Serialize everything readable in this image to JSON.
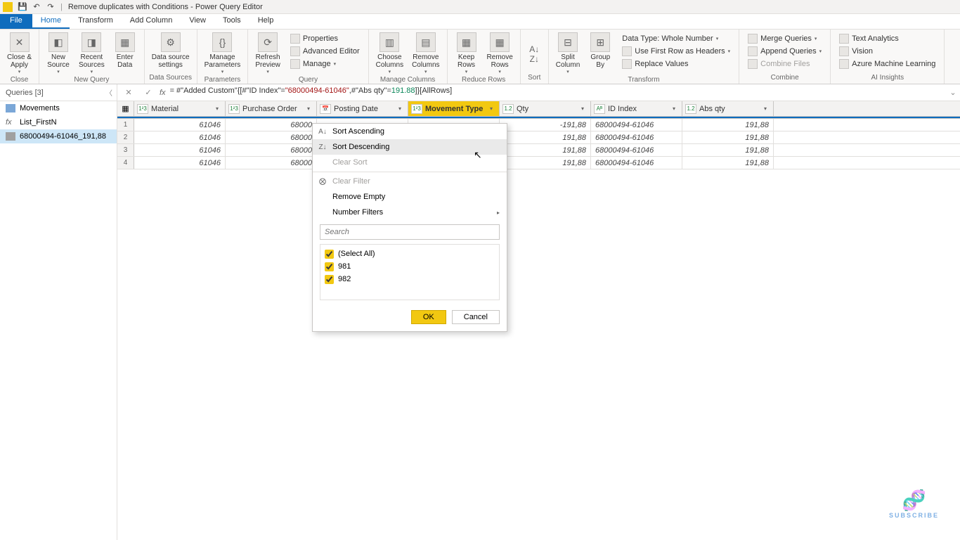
{
  "titlebar": {
    "title": "Remove duplicates with Conditions - Power Query Editor"
  },
  "tabs": [
    "File",
    "Home",
    "Transform",
    "Add Column",
    "View",
    "Tools",
    "Help"
  ],
  "ribbon": {
    "close": {
      "btn": "Close &\nApply",
      "group": "Close"
    },
    "newquery": {
      "new": "New\nSource",
      "recent": "Recent\nSources",
      "enter": "Enter\nData",
      "group": "New Query"
    },
    "datasources": {
      "ds": "Data source\nsettings",
      "group": "Data Sources"
    },
    "params": {
      "mp": "Manage\nParameters",
      "group": "Parameters"
    },
    "query": {
      "refresh": "Refresh\nPreview",
      "props": "Properties",
      "adv": "Advanced Editor",
      "manage": "Manage",
      "group": "Query"
    },
    "managecols": {
      "choose": "Choose\nColumns",
      "remove": "Remove\nColumns",
      "group": "Manage Columns"
    },
    "reducerows": {
      "keep": "Keep\nRows",
      "removerows": "Remove\nRows",
      "group": "Reduce Rows"
    },
    "sort": {
      "group": "Sort"
    },
    "transform": {
      "split": "Split\nColumn",
      "groupby": "Group\nBy",
      "datatype": "Data Type: Whole Number",
      "firstrow": "Use First Row as Headers",
      "replace": "Replace Values",
      "group": "Transform"
    },
    "combine": {
      "merge": "Merge Queries",
      "append": "Append Queries",
      "combine": "Combine Files",
      "group": "Combine"
    },
    "ai": {
      "text": "Text Analytics",
      "vision": "Vision",
      "aml": "Azure Machine Learning",
      "group": "AI Insights"
    }
  },
  "queries_header": "Queries [3]",
  "queries": [
    {
      "name": "Movements",
      "type": "table"
    },
    {
      "name": "List_FirstN",
      "type": "fx"
    },
    {
      "name": "68000494-61046_191,88",
      "type": "result",
      "selected": true
    }
  ],
  "formula_prefix": "= #\"Added Custom\"{[#\"ID Index\"=",
  "formula_s1": "\"68000494-61046\"",
  "formula_mid": ",#\"Abs qty\"=",
  "formula_n1": "191.88",
  "formula_suffix": "]}[AllRows]",
  "columns": [
    {
      "name": "Material",
      "type": "123",
      "w": "c-material"
    },
    {
      "name": "Purchase Order",
      "type": "123",
      "w": "c-po"
    },
    {
      "name": "Posting Date",
      "type": "cal",
      "w": "c-posting"
    },
    {
      "name": "Movement Type",
      "type": "123",
      "w": "c-move",
      "active": true
    },
    {
      "name": "Qty",
      "type": "1.2",
      "w": "c-qty"
    },
    {
      "name": "ID Index",
      "type": "ABC",
      "w": "c-idx"
    },
    {
      "name": "Abs qty",
      "type": "1.2",
      "w": "c-abs"
    }
  ],
  "rows": [
    {
      "n": "1",
      "material": "61046",
      "po": "68000",
      "qty": "-191,88",
      "idx": "68000494-61046",
      "abs": "191,88"
    },
    {
      "n": "2",
      "material": "61046",
      "po": "68000",
      "qty": "191,88",
      "idx": "68000494-61046",
      "abs": "191,88"
    },
    {
      "n": "3",
      "material": "61046",
      "po": "68000",
      "qty": "191,88",
      "idx": "68000494-61046",
      "abs": "191,88"
    },
    {
      "n": "4",
      "material": "61046",
      "po": "68000",
      "qty": "191,88",
      "idx": "68000494-61046",
      "abs": "191,88"
    }
  ],
  "popup": {
    "sort_asc": "Sort Ascending",
    "sort_desc": "Sort Descending",
    "clear_sort": "Clear Sort",
    "clear_filter": "Clear Filter",
    "remove_empty": "Remove Empty",
    "number_filters": "Number Filters",
    "search_placeholder": "Search",
    "select_all": "(Select All)",
    "v1": "981",
    "v2": "982",
    "ok": "OK",
    "cancel": "Cancel"
  },
  "subscribe": "SUBSCRIBE"
}
